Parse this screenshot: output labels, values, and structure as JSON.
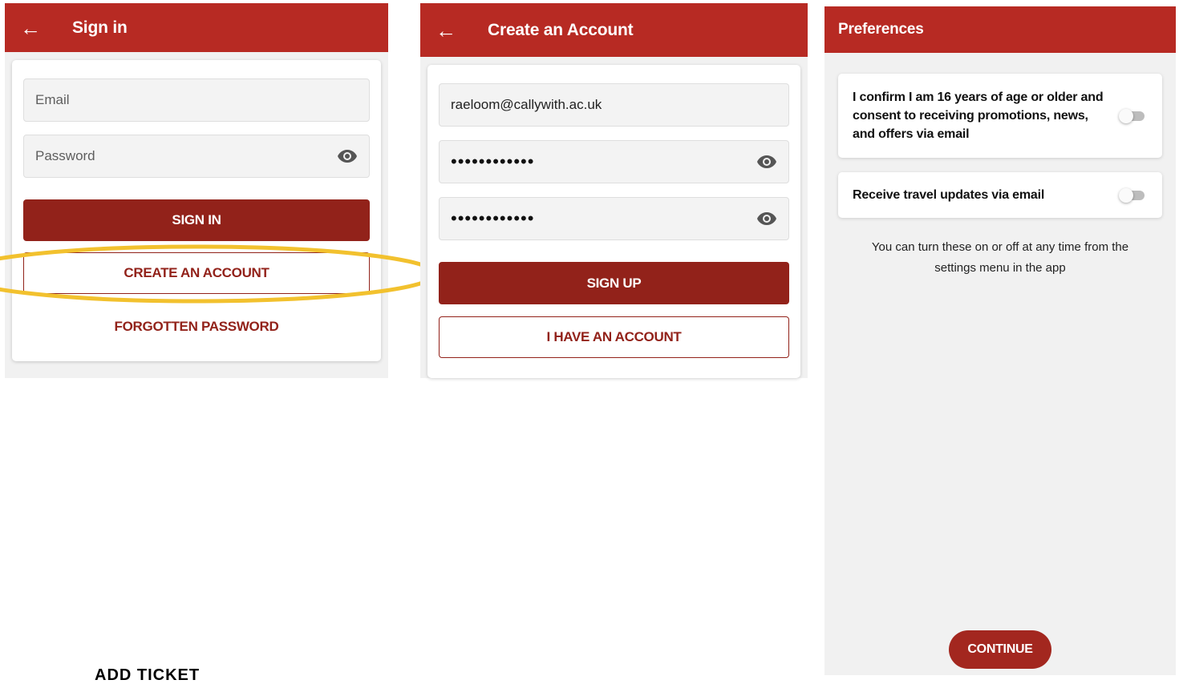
{
  "signin": {
    "title": "Sign in",
    "email_placeholder": "Email",
    "password_placeholder": "Password",
    "signin_button": "SIGN IN",
    "create_account_button": "CREATE AN ACCOUNT",
    "forgotten_password_link": "FORGOTTEN PASSWORD"
  },
  "create_account": {
    "title": "Create an Account",
    "email_value": "raeloom@callywith.ac.uk",
    "password_masked": "••••••••••••",
    "confirm_password_masked": "••••••••••••",
    "signup_button": "SIGN UP",
    "have_account_button": "I HAVE AN ACCOUNT"
  },
  "preferences": {
    "title": "Preferences",
    "items": [
      {
        "label": "I confirm I am 16 years of age or older and consent to receiving promotions, news, and offers via email",
        "enabled": false
      },
      {
        "label": "Receive travel updates via email",
        "enabled": false
      }
    ],
    "note": "You can turn these on or off at any time from the settings menu in the app",
    "continue_button": "CONTINUE"
  },
  "cutoff_text": "ADD TICKET",
  "colors": {
    "appbar": "#b72a23",
    "primary_button": "#92221a",
    "highlight": "#f2c12e"
  }
}
